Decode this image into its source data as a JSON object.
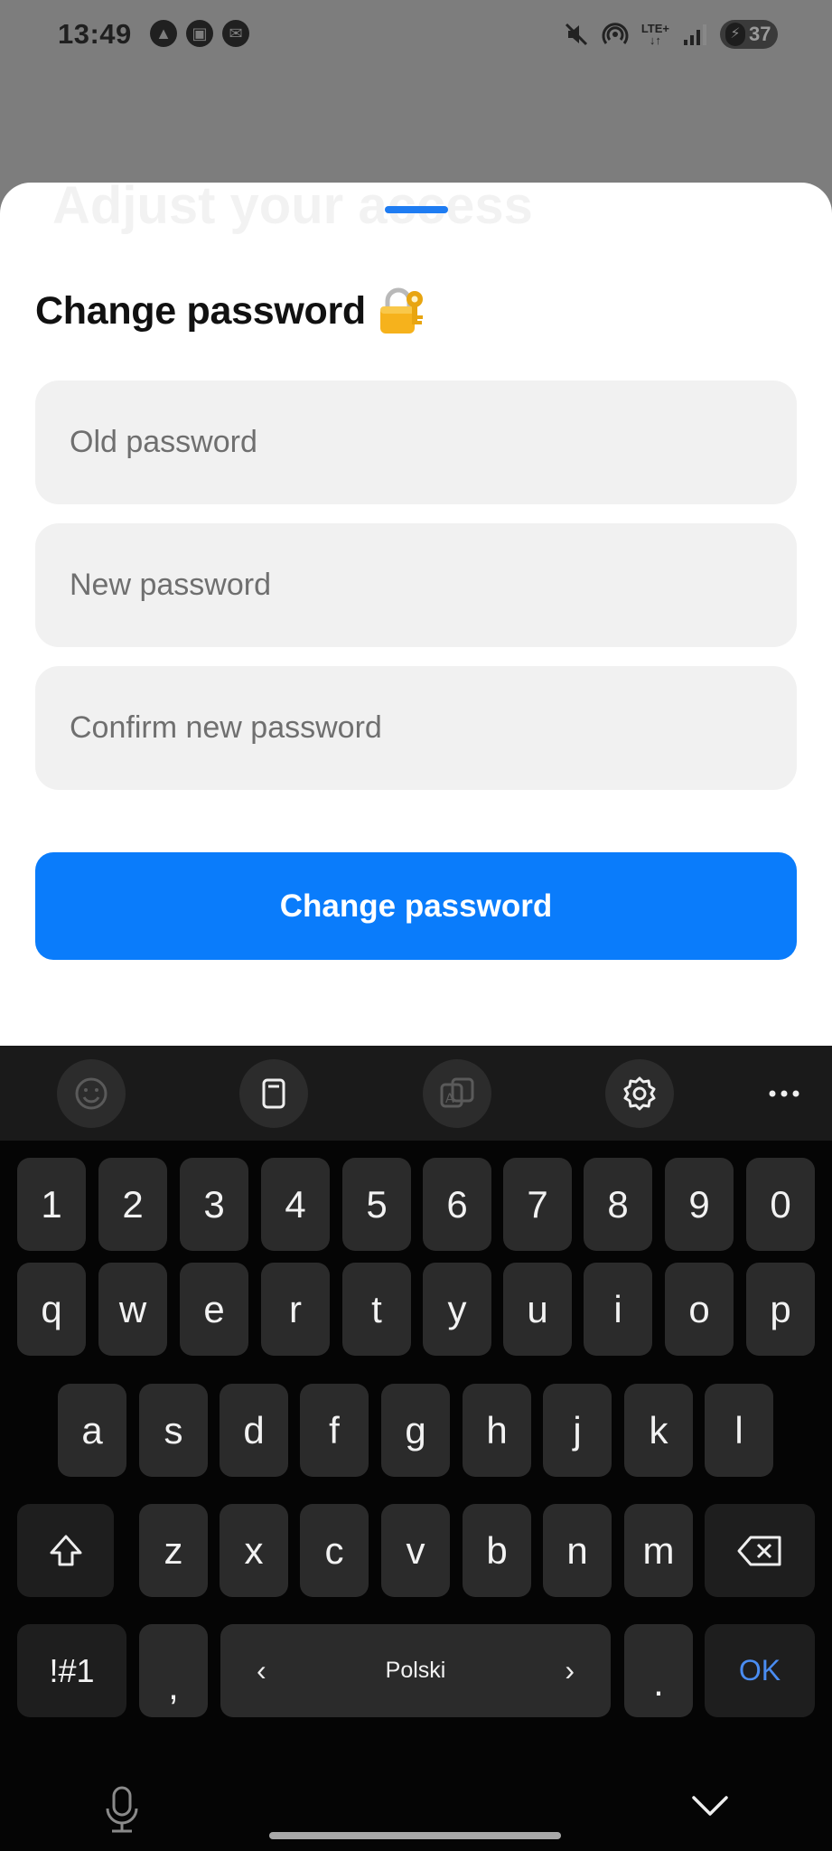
{
  "status_bar": {
    "time": "13:49",
    "network": "LTE+",
    "battery": "37"
  },
  "background_title": "Adjust your access",
  "sheet": {
    "title": "Change password",
    "fields": {
      "old_password": {
        "placeholder": "Old password",
        "value": ""
      },
      "new_password": {
        "placeholder": "New password",
        "value": ""
      },
      "confirm_password": {
        "placeholder": "Confirm new password",
        "value": ""
      }
    },
    "submit_label": "Change password"
  },
  "keyboard": {
    "language": "Polski",
    "number_row": [
      "1",
      "2",
      "3",
      "4",
      "5",
      "6",
      "7",
      "8",
      "9",
      "0"
    ],
    "row1": [
      "q",
      "w",
      "e",
      "r",
      "t",
      "y",
      "u",
      "i",
      "o",
      "p"
    ],
    "row2": [
      "a",
      "s",
      "d",
      "f",
      "g",
      "h",
      "j",
      "k",
      "l"
    ],
    "row3": [
      "z",
      "x",
      "c",
      "v",
      "b",
      "n",
      "m"
    ],
    "symbols_label": "!#1",
    "comma": ",",
    "period": ".",
    "ok_label": "OK"
  },
  "colors": {
    "accent": "#0A7CFB",
    "field_bg": "#F1F1F1",
    "keyboard_bg": "#050505",
    "key_bg": "#2B2B2B"
  }
}
